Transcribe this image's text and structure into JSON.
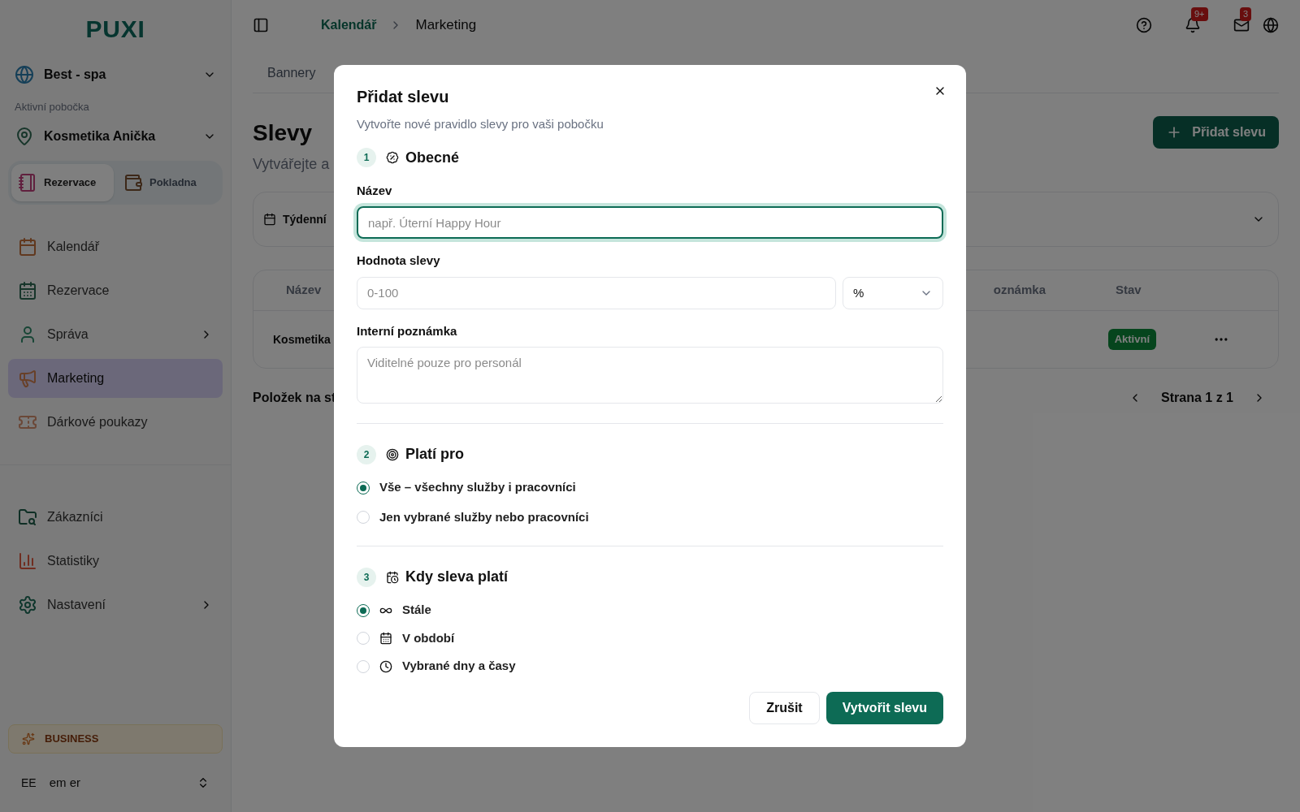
{
  "sidebar": {
    "logo": "PUXI",
    "workspace": "Best - spa",
    "branch_label": "Aktivní pobočka",
    "branch": "Kosmetika Anička",
    "modes": [
      {
        "label": "Rezervace",
        "selected": true
      },
      {
        "label": "Pokladna",
        "selected": false
      }
    ],
    "items": [
      {
        "label": "Kalendář",
        "kind": "link",
        "selected": false
      },
      {
        "label": "Rezervace",
        "kind": "link",
        "selected": false
      },
      {
        "label": "Správa",
        "kind": "group",
        "selected": false
      },
      {
        "label": "Marketing",
        "kind": "link",
        "selected": true
      },
      {
        "label": "Dárkové poukazy",
        "kind": "link",
        "selected": false
      }
    ],
    "bottom_items": [
      {
        "label": "Zákazníci",
        "kind": "link",
        "selected": false
      },
      {
        "label": "Statistiky",
        "kind": "link",
        "selected": false
      },
      {
        "label": "Nastavení",
        "kind": "group",
        "selected": false
      }
    ],
    "plan": "BUSINESS",
    "user": {
      "initials": "EE",
      "name": "em er"
    }
  },
  "header": {
    "breadcrumb": [
      "Kalendář",
      "Marketing"
    ],
    "notifications": "9+",
    "messages": "3"
  },
  "tabs": [
    {
      "label": "Bannery",
      "selected": false
    }
  ],
  "page": {
    "title": "Slevy",
    "subtitle": "Vytvářejte a",
    "add_button": "Přidat slevu",
    "filter": "Týdenní"
  },
  "table": {
    "columns": [
      "Název",
      "oznámka",
      "Stav"
    ],
    "rows": [
      {
        "name": "Kosmetika",
        "status": "Aktivní"
      }
    ]
  },
  "pagination": {
    "per_page_label": "Položek na st",
    "page": "Strana 1 z 1"
  },
  "dialog": {
    "title": "Přidat slevu",
    "subtitle": "Vytvořte nové pravidlo slevy pro vaši pobočku",
    "sections": [
      {
        "number": "1",
        "title": "Obecné",
        "fields": [
          {
            "label": "Název",
            "kind": "text",
            "placeholder": "např. Úterní Happy Hour",
            "focused": true
          },
          {
            "label": "Hodnota slevy",
            "kind": "number",
            "placeholder": "0-100",
            "unit": "%",
            "focused": false
          },
          {
            "label": "Interní poznámka",
            "kind": "textarea",
            "placeholder": "Viditelné pouze pro personál",
            "focused": false
          }
        ]
      },
      {
        "number": "2",
        "title": "Platí pro",
        "options": [
          {
            "label": "Vše – všechny služby i pracovníci",
            "selected": true
          },
          {
            "label": "Jen vybrané služby nebo pracovníci",
            "selected": false
          }
        ]
      },
      {
        "number": "3",
        "title": "Kdy sleva platí",
        "options": [
          {
            "label": "Stále",
            "selected": true
          },
          {
            "label": "V období",
            "selected": false
          },
          {
            "label": "Vybrané dny a časy",
            "selected": false
          }
        ]
      }
    ],
    "buttons": {
      "cancel": "Zrušit",
      "submit": "Vytvořit slevu"
    }
  }
}
